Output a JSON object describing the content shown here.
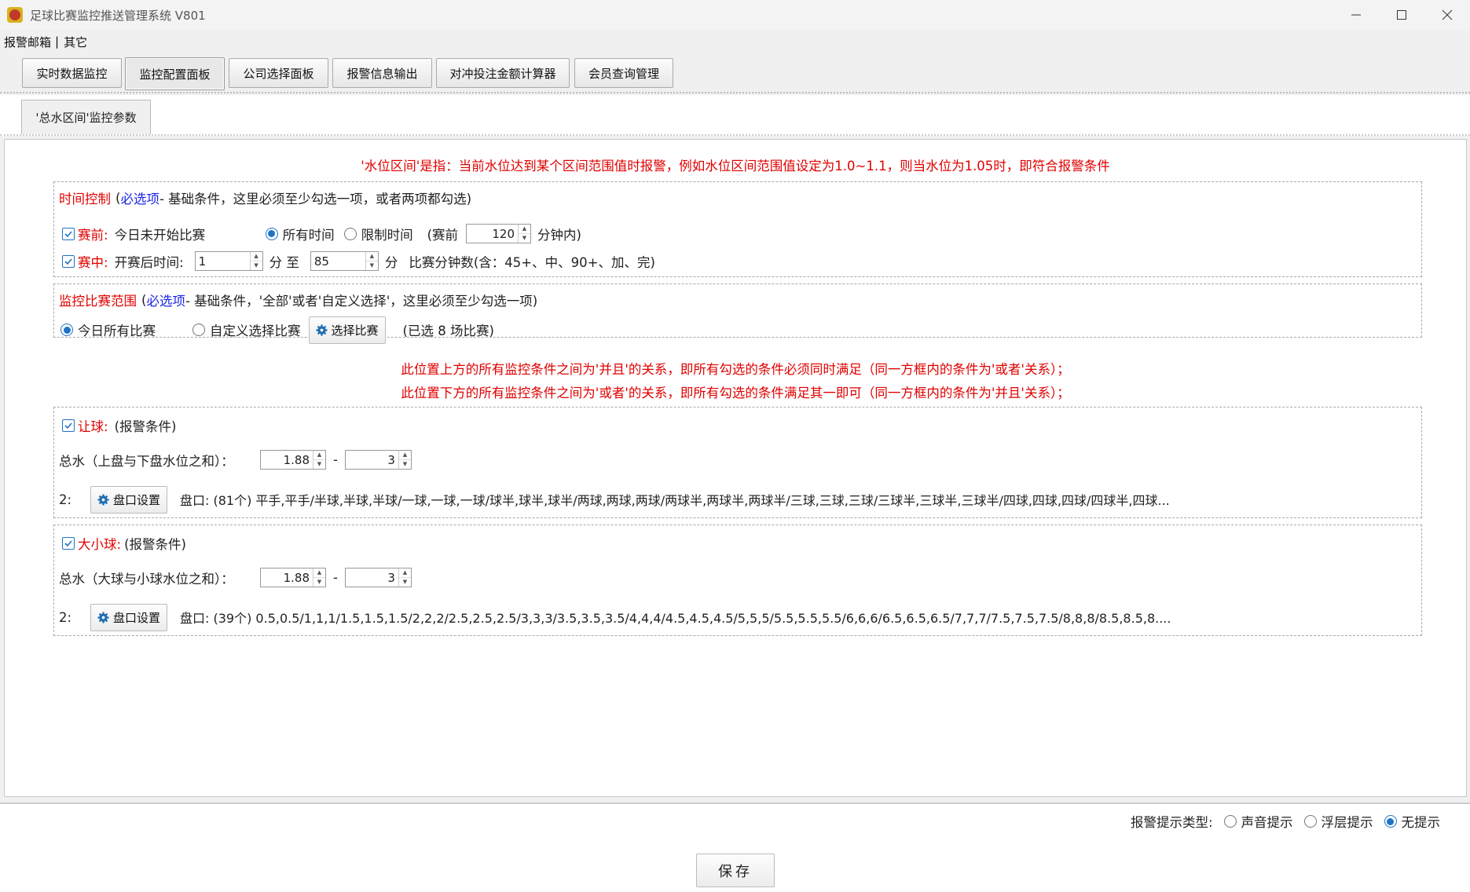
{
  "window": {
    "title": "足球比赛监控推送管理系统 V801"
  },
  "menu": {
    "items": [
      "报警邮箱",
      "其它"
    ],
    "separator": "|"
  },
  "main_tabs": [
    {
      "label": "实时数据监控"
    },
    {
      "label": "监控配置面板"
    },
    {
      "label": "公司选择面板"
    },
    {
      "label": "报警信息输出"
    },
    {
      "label": "对冲投注金额计算器"
    },
    {
      "label": "会员查询管理"
    }
  ],
  "active_main_tab": "监控配置面板",
  "sub_tab": {
    "label": "'总水区间'监控参数"
  },
  "notice_top": "'水位区间'是指：当前水位达到某个区间范围值时报警，例如水位区间范围值设定为1.0~1.1，则当水位为1.05时，即符合报警条件",
  "time_control": {
    "title": "时间控制",
    "paren_open": "(",
    "required": "必选项",
    "desc": " - 基础条件，这里必须至少勾选一项，或者两项都勾选)",
    "prematch": {
      "checked": true,
      "label": "赛前:",
      "desc": "今日未开始比赛",
      "opt_all": "所有时间",
      "opt_limit": "限制时间",
      "selected": "所有时间",
      "before_label": "(赛前",
      "minutes": "120",
      "after_label": "分钟内)"
    },
    "inplay": {
      "checked": true,
      "label": "赛中:",
      "desc": "开赛后时间:",
      "from": "1",
      "unit_from": "分 至",
      "to": "85",
      "unit_to": "分",
      "note": "比赛分钟数(含：45+、中、90+、加、完)"
    }
  },
  "match_scope": {
    "title": "监控比赛范围",
    "paren_open": "(",
    "required": "必选项",
    "desc": " - 基础条件，'全部'或者'自定义选择'，这里必须至少勾选一项)",
    "opt_all": "今日所有比赛",
    "opt_custom": "自定义选择比赛",
    "selected": "今日所有比赛",
    "select_button": "选择比赛",
    "selected_count": "(已选  8  场比赛)"
  },
  "notice_mid": [
    "此位置上方的所有监控条件之间为'并且'的关系，即所有勾选的条件必须同时满足（同一方框内的条件为'或者'关系）；",
    "此位置下方的所有监控条件之间为'或者'的关系，即所有勾选的条件满足其一即可（同一方框内的条件为'并且'关系）；"
  ],
  "handicap": {
    "checked": true,
    "label": "让球:",
    "cond": "(报警条件)",
    "total_label": "总水（上盘与下盘水位之和）：",
    "min": "1.88",
    "dash": "-",
    "max": "3",
    "index": "2:",
    "button": "盘口设置",
    "lines": "盘口: (81个) 平手,平手/半球,半球,半球/一球,一球,一球/球半,球半,球半/两球,两球,两球/两球半,两球半,两球半/三球,三球,三球/三球半,三球半,三球半/四球,四球,四球/四球半,四球..."
  },
  "overunder": {
    "checked": true,
    "label": "大小球:",
    "cond": "(报警条件)",
    "total_label": "总水（大球与小球水位之和）：",
    "min": "1.88",
    "dash": "-",
    "max": "3",
    "index": "2:",
    "button": "盘口设置",
    "lines": "盘口: (39个) 0.5,0.5/1,1,1/1.5,1.5,1.5/2,2,2/2.5,2.5,2.5/3,3,3/3.5,3.5,3.5/4,4,4/4.5,4.5,4.5/5,5,5/5.5,5.5,5.5/6,6,6/6.5,6.5,6.5/7,7,7/7.5,7.5,7.5/8,8,8/8.5,8.5,8...."
  },
  "alert_type": {
    "label": "报警提示类型:",
    "options": [
      "声音提示",
      "浮层提示",
      "无提示"
    ],
    "selected": "无提示"
  },
  "save_button": "保存",
  "colors": {
    "accent": "#1f73c7",
    "warning": "#e00000",
    "link": "#1a25e6"
  }
}
